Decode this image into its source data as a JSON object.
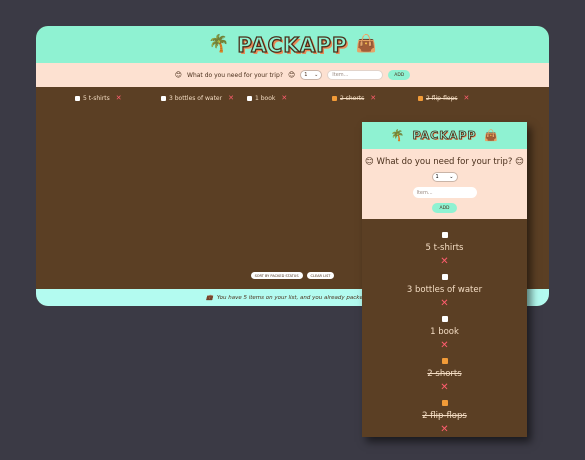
{
  "app": {
    "title": "PACKAPP",
    "left_emoji": "🌴",
    "right_emoji": "👜"
  },
  "form": {
    "question": "What do you need for your trip?",
    "face_emoji": "😊",
    "quantity_value": "1",
    "item_placeholder": "Item...",
    "add_label": "ADD"
  },
  "items": [
    {
      "label": "5 t-shirts",
      "packed": false
    },
    {
      "label": "3 bottles of water",
      "packed": false
    },
    {
      "label": "1 book",
      "packed": false
    },
    {
      "label": "2 shorts",
      "packed": true
    },
    {
      "label": "2 flip-flops",
      "packed": true
    }
  ],
  "controls": {
    "sort_label": "SORT BY PACKED STATUS",
    "clear_label": "CLEAR LIST"
  },
  "footer": {
    "icon": "💼",
    "text": "You have 5 items on your list, and you already packed 2 (4"
  },
  "colors": {
    "header_bg": "#8ff2d2",
    "form_bg": "#fde1d1",
    "list_bg": "#5b3f24",
    "footer_bg": "#b3fbf0",
    "delete_color": "#ff5d6e",
    "checked_color": "#f29b38"
  }
}
